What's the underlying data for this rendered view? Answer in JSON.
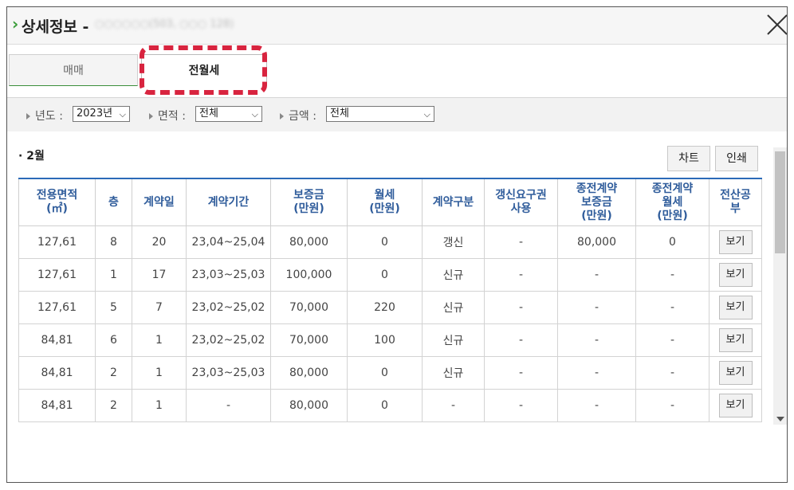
{
  "titlebar": {
    "title": "상세정보 -",
    "blurred_name": "○○○○○○(503, ○○○ 128)"
  },
  "tabs": [
    {
      "label": "매매"
    },
    {
      "label": "전월세"
    }
  ],
  "filters": {
    "year": {
      "label": "년도 :",
      "value": "2023년"
    },
    "area": {
      "label": "면적 :",
      "value": "전체"
    },
    "amount": {
      "label": "금액 :",
      "value": "전체"
    }
  },
  "section": {
    "title": "2월"
  },
  "buttons": {
    "chart": "차트",
    "print": "인쇄"
  },
  "table": {
    "headers": [
      "전용면적\n(㎡)",
      "층",
      "계약일",
      "계약기간",
      "보증금\n(만원)",
      "월세\n(만원)",
      "계약구분",
      "갱신요구권\n사용",
      "종전계약\n보증금\n(만원)",
      "종전계약\n월세\n(만원)",
      "전산공\n부"
    ],
    "rows": [
      [
        "127,61",
        "8",
        "20",
        "23,04~25,04",
        "80,000",
        "0",
        "갱신",
        "-",
        "80,000",
        "0",
        "보기"
      ],
      [
        "127,61",
        "1",
        "17",
        "23,03~25,03",
        "100,000",
        "0",
        "신규",
        "-",
        "-",
        "-",
        "보기"
      ],
      [
        "127,61",
        "5",
        "7",
        "23,02~25,02",
        "70,000",
        "220",
        "신규",
        "-",
        "-",
        "-",
        "보기"
      ],
      [
        "84,81",
        "6",
        "1",
        "23,02~25,02",
        "70,000",
        "100",
        "신규",
        "-",
        "-",
        "-",
        "보기"
      ],
      [
        "84,81",
        "2",
        "1",
        "23,03~25,03",
        "80,000",
        "0",
        "신규",
        "-",
        "-",
        "-",
        "보기"
      ],
      [
        "84,81",
        "2",
        "1",
        "-",
        "80,000",
        "0",
        "-",
        "-",
        "-",
        "-",
        "보기"
      ]
    ]
  }
}
